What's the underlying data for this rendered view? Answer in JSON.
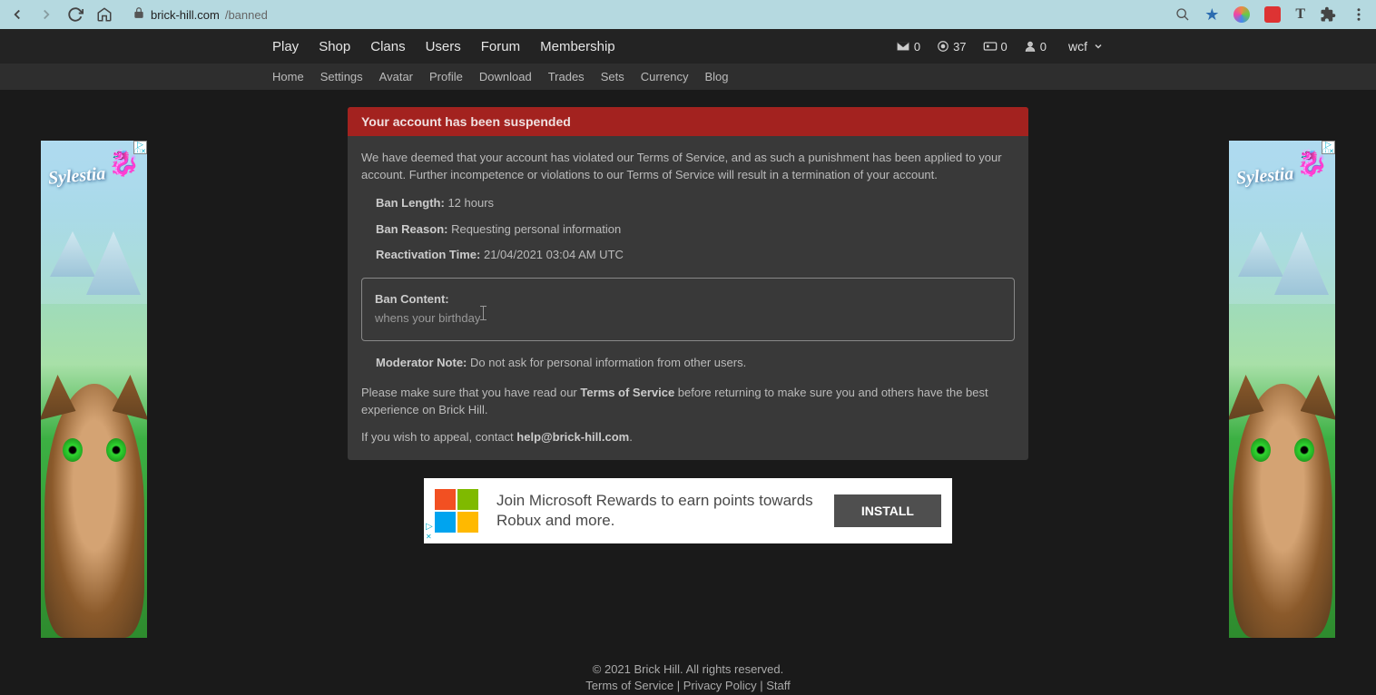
{
  "browser": {
    "url_domain": "brick-hill.com",
    "url_path": "/banned"
  },
  "nav": {
    "main": [
      "Play",
      "Shop",
      "Clans",
      "Users",
      "Forum",
      "Membership"
    ],
    "sub": [
      "Home",
      "Settings",
      "Avatar",
      "Profile",
      "Download",
      "Trades",
      "Sets",
      "Currency",
      "Blog"
    ],
    "stats": {
      "messages": "0",
      "bits": "37",
      "bucks": "0",
      "friends": "0"
    },
    "username": "wcf"
  },
  "ban": {
    "header": "Your account has been suspended",
    "intro": "We have deemed that your account has violated our Terms of Service, and as such a punishment has been applied to your account. Further incompetence or violations to our Terms of Service will result in a termination of your account.",
    "length_label": "Ban Length:",
    "length_value": " 12 hours",
    "reason_label": "Ban Reason:",
    "reason_value": " Requesting personal information",
    "reactivation_label": "Reactivation Time:",
    "reactivation_value": " 21/04/2021 03:04 AM UTC",
    "content_label": "Ban Content:",
    "content_value": "whens your birthday",
    "mod_note_label": "Moderator Note:",
    "mod_note_value": " Do not ask for personal information from other users.",
    "tos_pre": "Please make sure that you have read our ",
    "tos_link": "Terms of Service",
    "tos_post": " before returning to make sure you and others have the best experience on Brick Hill.",
    "appeal_pre": "If you wish to appeal, contact ",
    "appeal_email": "help@brick-hill.com",
    "appeal_post": "."
  },
  "ad_banner": {
    "text": "Join Microsoft Rewards to earn points towards Robux and more.",
    "button": "INSTALL"
  },
  "side_ad": {
    "logo": "Sylestia"
  },
  "footer": {
    "copyright": "© 2021 Brick Hill. All rights reserved.",
    "tos": "Terms of Service",
    "privacy": "Privacy Policy",
    "staff": "Staff",
    "sep": " | "
  }
}
